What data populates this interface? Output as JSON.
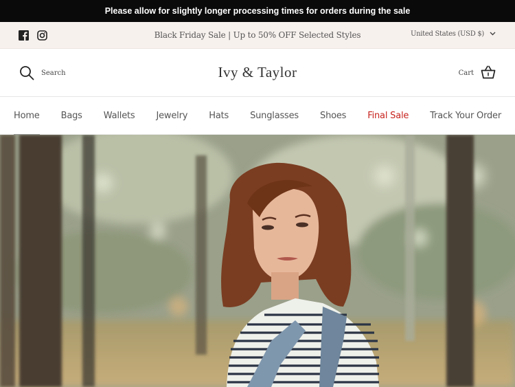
{
  "announcement": {
    "text": "Please allow for slightly longer processing times for orders during the sale"
  },
  "promo": {
    "text": "Black Friday Sale | Up to 50% OFF Selected Styles"
  },
  "social": {
    "facebook_icon": "facebook-icon",
    "instagram_icon": "instagram-icon"
  },
  "currency": {
    "label": "United States (USD $)"
  },
  "header": {
    "search_label": "Search",
    "logo": "Ivy & Taylor",
    "cart_label": "Cart"
  },
  "nav": {
    "items": [
      {
        "label": "Home"
      },
      {
        "label": "Bags"
      },
      {
        "label": "Wallets"
      },
      {
        "label": "Jewelry"
      },
      {
        "label": "Hats"
      },
      {
        "label": "Sunglasses"
      },
      {
        "label": "Shoes"
      },
      {
        "label": "Final Sale"
      },
      {
        "label": "Track Your Order"
      }
    ]
  },
  "colors": {
    "announcement_bg": "#0a0a0a",
    "promo_bg": "#f7f1ee",
    "sale_red": "#c7231e",
    "text": "#555555"
  }
}
